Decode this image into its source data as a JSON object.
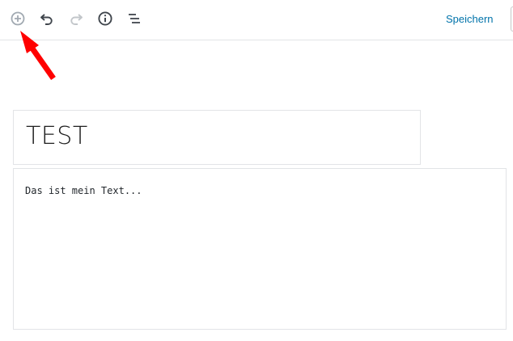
{
  "toolbar": {
    "icons": {
      "add_block": "plus-circle-icon",
      "undo": "undo-icon",
      "redo": "redo-icon",
      "info": "info-icon",
      "outline": "list-outline-icon"
    },
    "save_label": "Speichern"
  },
  "editor": {
    "title": "TEST",
    "paragraph": "Das ist mein Text..."
  },
  "colors": {
    "accent": "#0073aa",
    "annotation_arrow": "#ff0000",
    "border": "#e2e4e7"
  }
}
